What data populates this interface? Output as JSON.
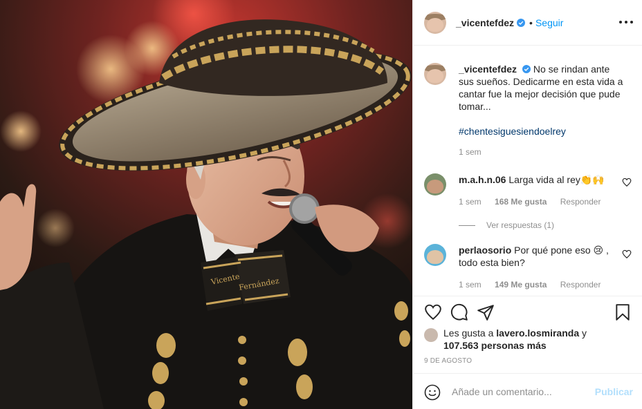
{
  "post": {
    "author": {
      "username": "_vicentefdez",
      "verified": true,
      "follow_label": "Seguir",
      "separator": "•"
    },
    "more_icon": "more-horizontal-icon",
    "media": {
      "printed_text_on_tie": "Vicente Fernández"
    },
    "caption": {
      "username": "_vicentefdez",
      "text": "No se rindan ante sus sueños. Dedicarme en esta vida a cantar fue la mejor decisión que pude tomar...",
      "hashtag": "#chentesiguesiendoelrey",
      "time": "1 sem"
    },
    "comments": [
      {
        "username": "m.a.h.n.06",
        "text": "Larga vida al rey👏🙌",
        "time": "1 sem",
        "likes": "168 Me gusta",
        "reply_label": "Responder",
        "view_replies": "Ver respuestas (1)"
      },
      {
        "username": "perlaosorio",
        "text": "Por qué pone eso 😢 , todo esta bien?",
        "time": "1 sem",
        "likes": "149 Me gusta",
        "reply_label": "Responder"
      }
    ],
    "actions": {
      "icons": [
        "heart-icon",
        "comment-icon",
        "share-icon",
        "bookmark-icon"
      ]
    },
    "likes_summary": {
      "prefix": "Les gusta a ",
      "user": "lavero.losmiranda",
      "middle": " y ",
      "count": "107.563 personas más"
    },
    "date": "9 DE AGOSTO",
    "add_comment": {
      "placeholder": "Añade un comentario...",
      "publish_label": "Publicar"
    },
    "colors": {
      "link_blue": "#0095f6",
      "publish_disabled": "#b2dffc",
      "hashtag": "#00376b",
      "muted": "#8e8e8e",
      "text": "#262626",
      "border": "#efefef"
    }
  }
}
